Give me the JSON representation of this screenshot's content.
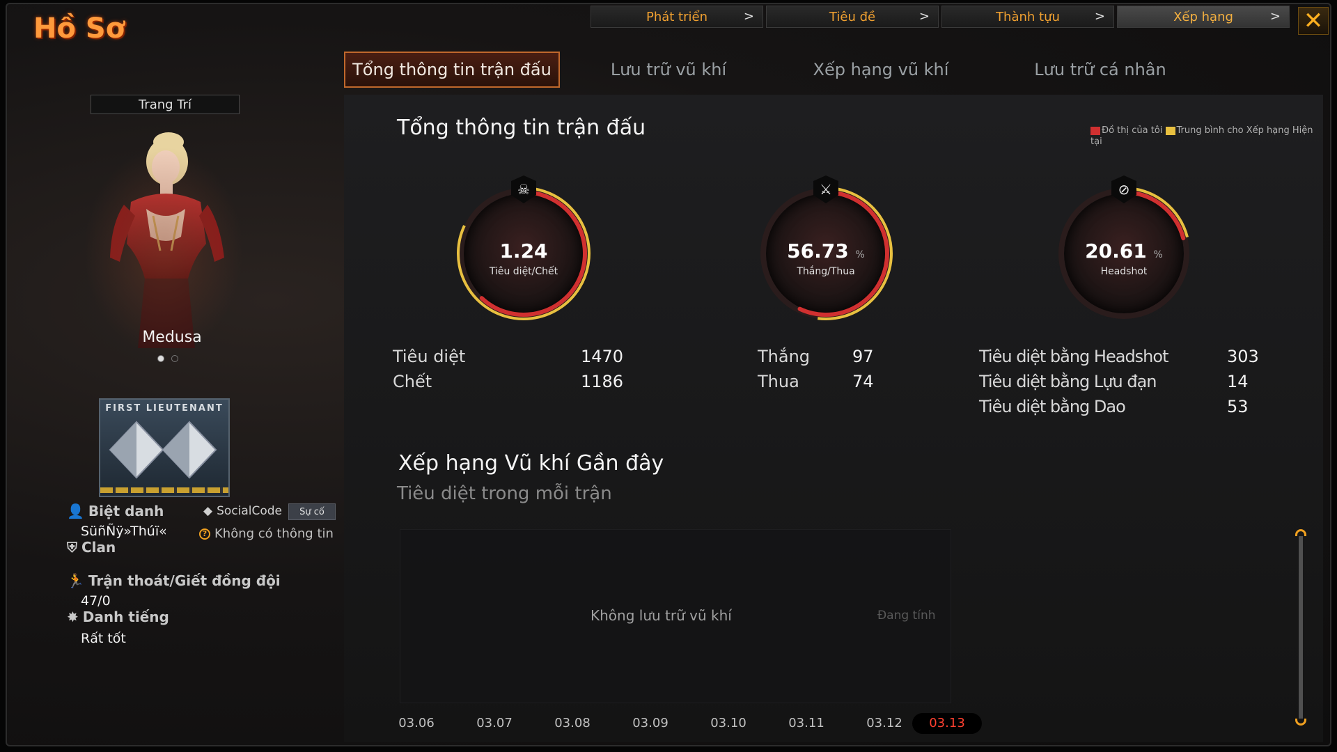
{
  "window": {
    "title": "Hồ Sơ"
  },
  "top_nav": [
    {
      "label": "Phát triển",
      "active": false
    },
    {
      "label": "Tiêu đề",
      "active": false
    },
    {
      "label": "Thành tựu",
      "active": false
    },
    {
      "label": "Xếp hạng",
      "active": true
    }
  ],
  "sub_tabs": [
    {
      "label": "Tổng thông tin trận đấu",
      "active": true
    },
    {
      "label": "Lưu trữ vũ khí",
      "active": false
    },
    {
      "label": "Xếp hạng vũ khí",
      "active": false
    },
    {
      "label": "Lưu trữ cá nhân",
      "active": false
    }
  ],
  "profile": {
    "decor_label": "Trang Trí",
    "character_name": "Medusa",
    "rank_title": "FIRST LIEUTENANT",
    "nickname_label": "Biệt danh",
    "nickname": "SüñÑÿ»Thúï«",
    "socialcode_label": "SocialCode",
    "incident_button": "Sự cố",
    "socialcode_value": "Không có thông tin",
    "clan_label": "Clan",
    "desert_label": "Trận thoát/Giết đồng đội",
    "desert_value": "47/0",
    "reputation_label": "Danh tiếng",
    "reputation_value": "Rất tốt"
  },
  "battle_summary": {
    "title": "Tổng thông tin trận đấu",
    "legend": {
      "mine": "Đồ thị của tôi",
      "mine_color": "#d03030",
      "avg": "Trung bình cho Xếp hạng Hiện tại",
      "avg_color": "#e8c040"
    },
    "gauges": [
      {
        "value": "1.24",
        "unit": "",
        "label": "Tiêu diệt/Chết",
        "icon": "skull-crossbones-icon",
        "mine_fraction": 0.62,
        "avg_fraction": 0.82
      },
      {
        "value": "56.73",
        "unit": "%",
        "label": "Thắng/Thua",
        "icon": "crossed-swords-icon",
        "mine_fraction": 0.57,
        "avg_fraction": 0.52
      },
      {
        "value": "20.61",
        "unit": "%",
        "label": "Headshot",
        "icon": "no-target-icon",
        "mine_fraction": 0.21,
        "avg_fraction": 0.21
      }
    ],
    "stats": {
      "kills_label": "Tiêu diệt",
      "kills": "1470",
      "deaths_label": "Chết",
      "deaths": "1186",
      "wins_label": "Thắng",
      "wins": "97",
      "losses_label": "Thua",
      "losses": "74",
      "hs_label": "Tiêu diệt bằng Headshot",
      "hs": "303",
      "grenade_label": "Tiêu diệt bằng Lựu đạn",
      "grenade": "14",
      "knife_label": "Tiêu diệt bằng Dao",
      "knife": "53"
    }
  },
  "weapon_ranking": {
    "title": "Xếp hạng Vũ khí Gần đây",
    "subtitle": "Tiêu diệt trong mỗi trận",
    "empty_text": "Không lưu trữ vũ khí",
    "status_text": "Đang tính",
    "dates": [
      "03.06",
      "03.07",
      "03.08",
      "03.09",
      "03.10",
      "03.11",
      "03.12",
      "03.13"
    ],
    "active_date": "03.13"
  },
  "colors": {
    "accent": "#f0a020",
    "title": "#ff9a3c"
  }
}
